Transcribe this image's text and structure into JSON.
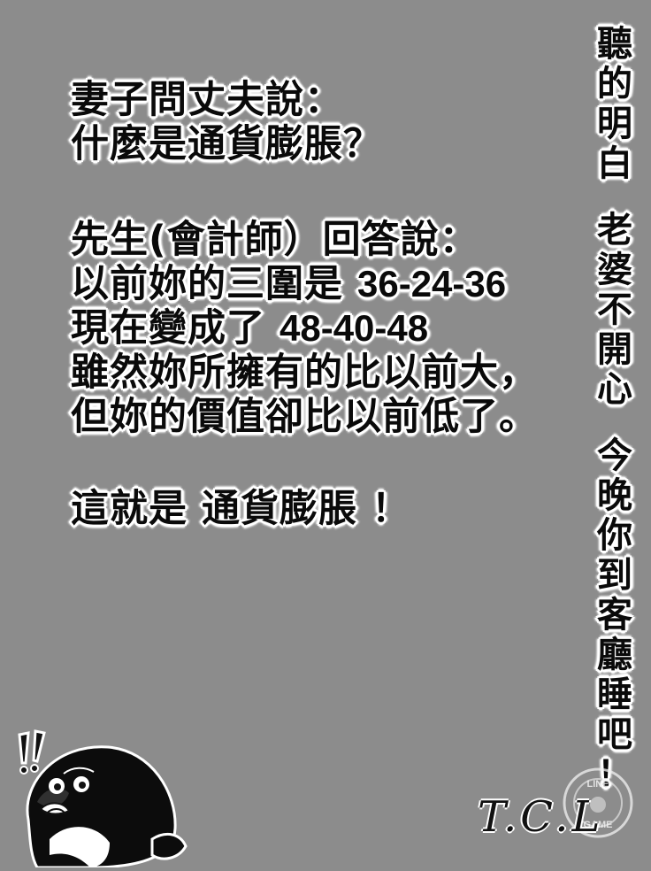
{
  "main_text": {
    "line1": "妻子問丈夫說：",
    "line2": "什麼是通貨膨脹？",
    "line3": "先生(會計師）回答說：",
    "line4_prefix": "以前妳的三圍是 ",
    "line4_number": "36-24-36",
    "line5_prefix": "現在變成了 ",
    "line5_number": "48-40-48",
    "line6": "雖然妳所擁有的比以前大，",
    "line7": "但妳的價值卻比以前低了。",
    "line8": "這就是  通貨膨脹 ！"
  },
  "vertical_text": {
    "part1": [
      "聽",
      "的",
      "明",
      "白"
    ],
    "part2": [
      "老",
      "婆",
      "不",
      "開",
      "心"
    ],
    "part3": [
      "今",
      "晚",
      "你",
      "到",
      "客",
      "廳",
      "睡",
      "吧",
      "！"
    ]
  },
  "signature": "T.C.L",
  "stamp_text": {
    "top": "LINE",
    "bottom": "GAME"
  },
  "icons": {
    "character": "surprised-penguin-icon",
    "exclamation": "double-exclamation-icon"
  },
  "colors": {
    "background": "#8c8c8c",
    "text": "#0a0a0a",
    "outline": "#ffffff"
  }
}
